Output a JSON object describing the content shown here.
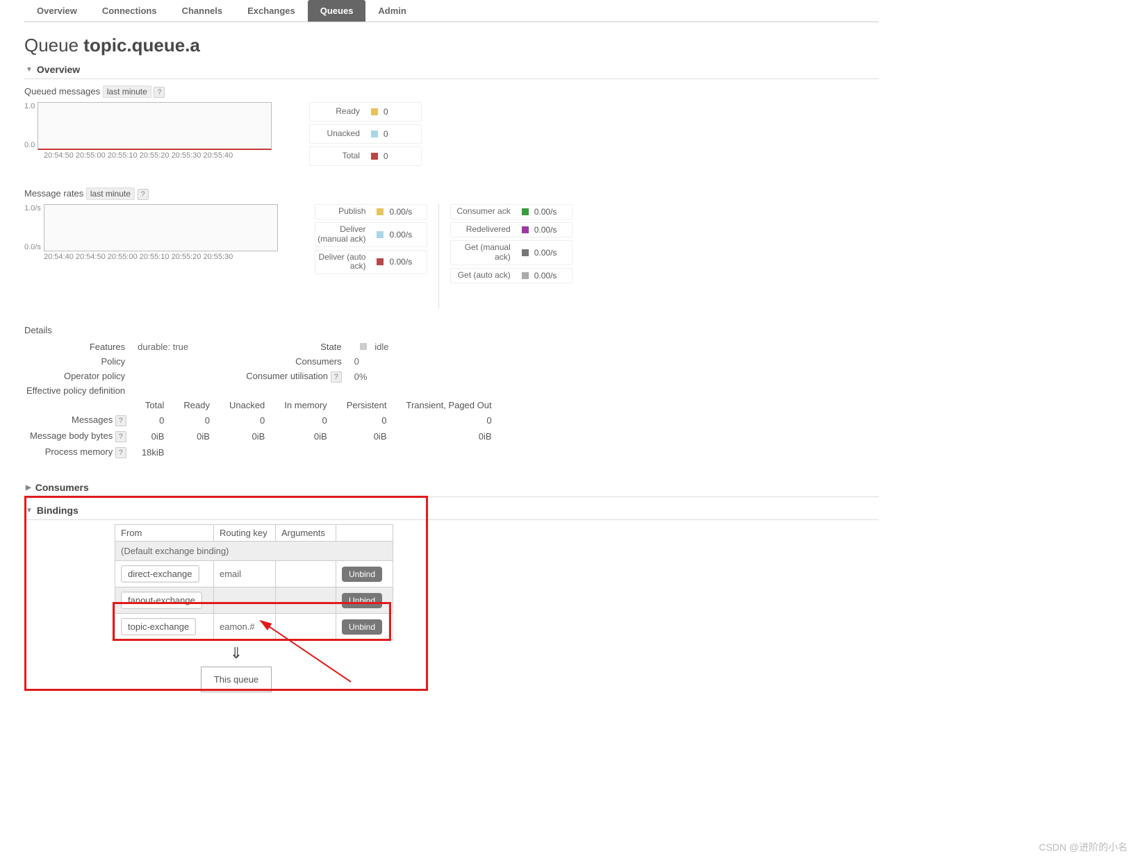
{
  "tabs": [
    "Overview",
    "Connections",
    "Channels",
    "Exchanges",
    "Queues",
    "Admin"
  ],
  "tabs_selected": 4,
  "title_prefix": "Queue ",
  "title_name": "topic.queue.a",
  "sections": {
    "overview": "Overview",
    "consumers": "Consumers",
    "bindings": "Bindings"
  },
  "queued_label": "Queued messages",
  "rates_label": "Message rates",
  "last_minute": "last minute",
  "chart_data": [
    {
      "type": "line",
      "title": "Queued messages",
      "ylabel": "",
      "xlabel": "",
      "ylim_label_top": "1.0",
      "ylim_label_bot": "0.0",
      "x_ticks": [
        "20:54:50",
        "20:55:00",
        "20:55:10",
        "20:55:20",
        "20:55:30",
        "20:55:40"
      ],
      "series": [
        {
          "name": "Ready",
          "values": [
            0,
            0,
            0,
            0,
            0,
            0
          ],
          "color": "#e6c35c"
        },
        {
          "name": "Unacked",
          "values": [
            0,
            0,
            0,
            0,
            0,
            0
          ],
          "color": "#a8d6e8"
        },
        {
          "name": "Total",
          "values": [
            0,
            0,
            0,
            0,
            0,
            0
          ],
          "color": "#b84747"
        }
      ]
    },
    {
      "type": "line",
      "title": "Message rates",
      "ylabel": "",
      "xlabel": "",
      "ylim_label_top": "1.0/s",
      "ylim_label_bot": "0.0/s",
      "x_ticks": [
        "20:54:40",
        "20:54:50",
        "20:55:00",
        "20:55:10",
        "20:55:20",
        "20:55:30"
      ],
      "series": [
        {
          "name": "Publish",
          "values": [
            0,
            0,
            0,
            0,
            0,
            0
          ],
          "color": "#e6c35c"
        },
        {
          "name": "Deliver (manual ack)",
          "values": [
            0,
            0,
            0,
            0,
            0,
            0
          ],
          "color": "#a8d6e8"
        },
        {
          "name": "Deliver (auto ack)",
          "values": [
            0,
            0,
            0,
            0,
            0,
            0
          ],
          "color": "#b84747"
        },
        {
          "name": "Consumer ack",
          "values": [
            0,
            0,
            0,
            0,
            0,
            0
          ],
          "color": "#3a9c3a"
        },
        {
          "name": "Redelivered",
          "values": [
            0,
            0,
            0,
            0,
            0,
            0
          ],
          "color": "#9b3aa6"
        },
        {
          "name": "Get (manual ack)",
          "values": [
            0,
            0,
            0,
            0,
            0,
            0
          ],
          "color": "#777"
        },
        {
          "name": "Get (auto ack)",
          "values": [
            0,
            0,
            0,
            0,
            0,
            0
          ],
          "color": "#aaa"
        }
      ]
    }
  ],
  "legend1": [
    {
      "label": "Ready",
      "color": "#e6c35c",
      "value": "0"
    },
    {
      "label": "Unacked",
      "color": "#a8d6e8",
      "value": "0"
    },
    {
      "label": "Total",
      "color": "#b84747",
      "value": "0"
    }
  ],
  "legend2a": [
    {
      "label": "Publish",
      "color": "#e6c35c",
      "value": "0.00/s"
    },
    {
      "label": "Deliver (manual ack)",
      "color": "#a8d6e8",
      "value": "0.00/s"
    },
    {
      "label": "Deliver (auto ack)",
      "color": "#b84747",
      "value": "0.00/s"
    }
  ],
  "legend2b": [
    {
      "label": "Consumer ack",
      "color": "#3a9c3a",
      "value": "0.00/s"
    },
    {
      "label": "Redelivered",
      "color": "#9b3aa6",
      "value": "0.00/s"
    },
    {
      "label": "Get (manual ack)",
      "color": "#777",
      "value": "0.00/s"
    },
    {
      "label": "Get (auto ack)",
      "color": "#aaa",
      "value": "0.00/s"
    }
  ],
  "details_label": "Details",
  "details_left": {
    "Features": "durable: true",
    "Policy": "",
    "Operator policy": "",
    "Effective policy definition": ""
  },
  "details_mid": {
    "State": "idle",
    "Consumers": "0",
    "Consumer utilisation": "0%"
  },
  "state_color": "#ccc",
  "stats_headers": [
    "Total",
    "Ready",
    "Unacked",
    "In memory",
    "Persistent",
    "Transient, Paged Out"
  ],
  "stats_rows": [
    {
      "label": "Messages",
      "cells": [
        "0",
        "0",
        "0",
        "0",
        "0",
        "0"
      ]
    },
    {
      "label": "Message body bytes",
      "cells": [
        "0iB",
        "0iB",
        "0iB",
        "0iB",
        "0iB",
        "0iB"
      ]
    },
    {
      "label": "Process memory",
      "cells": [
        "18kiB",
        "",
        "",
        "",
        "",
        ""
      ]
    }
  ],
  "bindings": {
    "headers": [
      "From",
      "Routing key",
      "Arguments",
      ""
    ],
    "default_row": "(Default exchange binding)",
    "rows": [
      {
        "from": "direct-exchange",
        "key": "email",
        "args": "",
        "btn": "Unbind"
      },
      {
        "from": "fanout-exchange",
        "key": "",
        "args": "",
        "btn": "Unbind"
      },
      {
        "from": "topic-exchange",
        "key": "eamon.#",
        "args": "",
        "btn": "Unbind"
      }
    ],
    "this_queue": "This queue",
    "arrow": "⇓"
  },
  "watermark": "CSDN @进阶的小名"
}
